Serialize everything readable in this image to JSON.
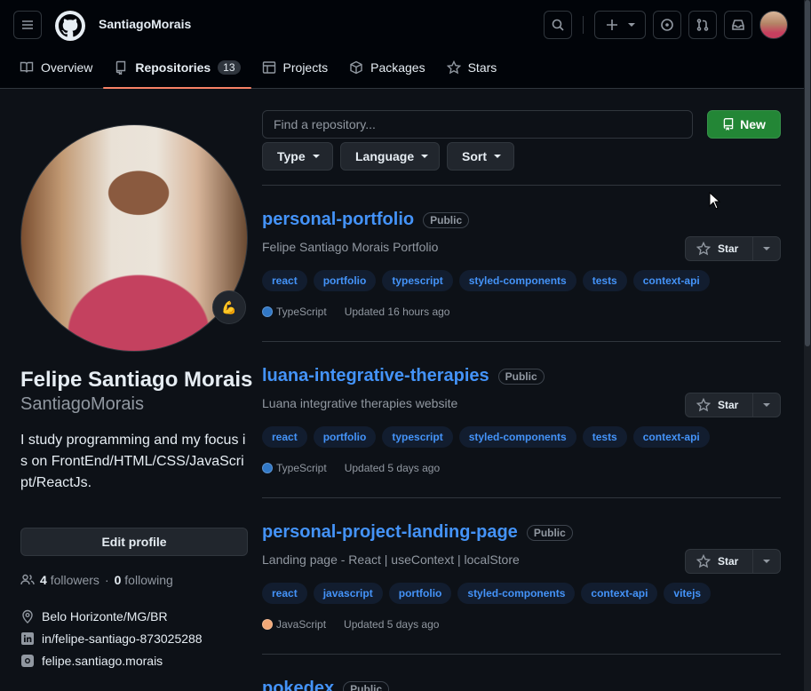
{
  "header": {
    "username": "SantiagoMorais",
    "icons": [
      "menu-icon",
      "github-logo-icon",
      "search-icon",
      "plus-icon",
      "chevron-down-icon",
      "issues-icon",
      "pull-request-icon",
      "inbox-icon"
    ]
  },
  "tabs": [
    {
      "label": "Overview",
      "icon": "book-icon"
    },
    {
      "label": "Repositories",
      "count": "13",
      "icon": "repo-icon"
    },
    {
      "label": "Projects",
      "icon": "table-icon"
    },
    {
      "label": "Packages",
      "icon": "package-icon"
    },
    {
      "label": "Stars",
      "icon": "star-icon"
    }
  ],
  "profile": {
    "full_name": "Felipe Santiago Morais",
    "login": "SantiagoMorais",
    "bio": "I study programming and my focus is on FrontEnd/HTML/CSS/JavaScript/ReactJs.",
    "status_emoji": "💪",
    "edit_label": "Edit profile",
    "followers_count": "4",
    "followers_label": "followers",
    "dot": "·",
    "following_count": "0",
    "following_label": "following",
    "location": "Belo Horizonte/MG/BR",
    "linkedin": "in/felipe-santiago-873025288",
    "instagram": "felipe.santiago.morais"
  },
  "toolbar": {
    "search_placeholder": "Find a repository...",
    "new_label": "New",
    "filters": [
      "Type",
      "Language",
      "Sort"
    ]
  },
  "repos": [
    {
      "name": "personal-portfolio",
      "visibility": "Public",
      "description": "Felipe Santiago Morais Portfolio",
      "topics": [
        "react",
        "portfolio",
        "typescript",
        "styled-components",
        "tests",
        "context-api"
      ],
      "language": "TypeScript",
      "lang_color": "#3178c6",
      "updated": "Updated 16 hours ago",
      "star_label": "Star"
    },
    {
      "name": "luana-integrative-therapies",
      "visibility": "Public",
      "description": "Luana integrative therapies website",
      "topics": [
        "react",
        "portfolio",
        "typescript",
        "styled-components",
        "tests",
        "context-api"
      ],
      "language": "TypeScript",
      "lang_color": "#3178c6",
      "updated": "Updated 5 days ago",
      "star_label": "Star"
    },
    {
      "name": "personal-project-landing-page",
      "visibility": "Public",
      "description": "Landing page - React | useContext | localStore",
      "topics": [
        "react",
        "javascript",
        "portfolio",
        "styled-components",
        "context-api",
        "vitejs"
      ],
      "language": "JavaScript",
      "lang_color": "#f1a877",
      "updated": "Updated 5 days ago",
      "star_label": "Star"
    },
    {
      "name": "pokedex",
      "visibility": "Public"
    }
  ],
  "colors": {
    "accent_link": "#4493f8",
    "new_button": "#238636",
    "tab_underline": "#f78166"
  }
}
